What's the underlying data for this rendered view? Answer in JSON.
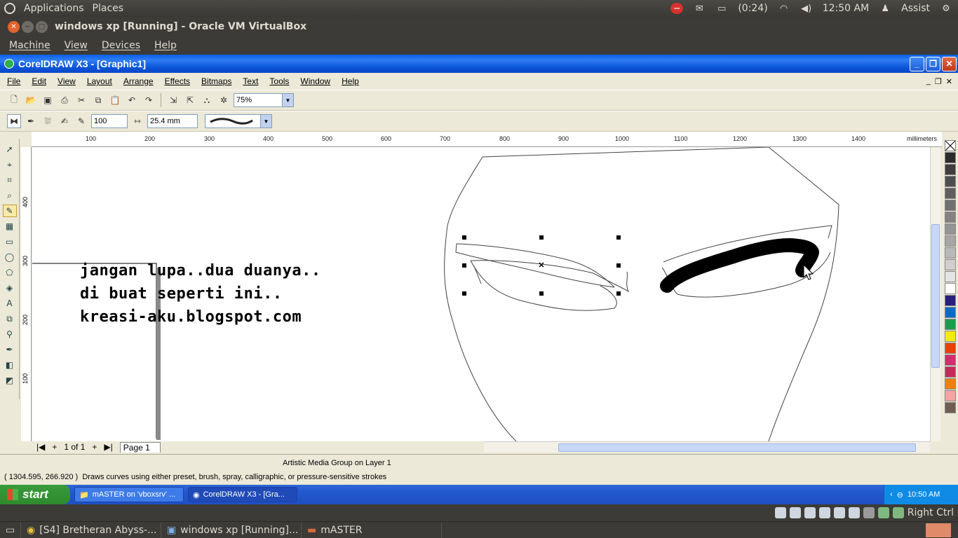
{
  "top_panel": {
    "applications": "Applications",
    "places": "Places",
    "battery": "(0:24)",
    "time": "12:50 AM",
    "user": "Assist"
  },
  "vbox": {
    "title": "windows xp [Running] - Oracle VM VirtualBox",
    "menu": [
      "Machine",
      "View",
      "Devices",
      "Help"
    ],
    "host_key": "Right Ctrl"
  },
  "coreldraw": {
    "title": "CorelDRAW X3 - [Graphic1]",
    "menu": [
      "File",
      "Edit",
      "View",
      "Layout",
      "Arrange",
      "Effects",
      "Bitmaps",
      "Text",
      "Tools",
      "Window",
      "Help"
    ],
    "zoom": "75%",
    "smoothing": "100",
    "width": "25.4 mm",
    "ruler_unit": "millimeters",
    "ruler_h": [
      "100",
      "200",
      "300",
      "400",
      "500",
      "600",
      "700",
      "800",
      "900",
      "1000",
      "1100",
      "1200",
      "1300",
      "1400"
    ],
    "ruler_v": [
      "400",
      "300",
      "200",
      "100"
    ],
    "canvas_text": [
      "jangan lupa..dua duanya..",
      "di buat seperti ini..",
      "kreasi-aku.blogspot.com"
    ],
    "page_count": "1 of 1",
    "page_tab": "Page 1",
    "status_object": "Artistic Media Group on Layer 1",
    "status_coords": "( 1304.595, 266.920 )",
    "status_hint": "Draws curves using either preset, brush, spray, calligraphic, or pressure-sensitive strokes",
    "palette": [
      "#2b2b2b",
      "#3d3d3d",
      "#4e4e4e",
      "#5f5f5f",
      "#707070",
      "#828282",
      "#949494",
      "#a6a6a6",
      "#b9b9b9",
      "#cfcfcf",
      "#e4e4e4",
      "#ffffff",
      "#2a1f7a",
      "#0a6bc4",
      "#1c9c4a",
      "#f4ea11",
      "#e8410c",
      "#d22d6e",
      "#c22c58",
      "#f07f12",
      "#f5a3a3",
      "#6e5e52"
    ]
  },
  "xp_taskbar": {
    "start": "start",
    "buttons": [
      "mASTER on 'vboxsrv' ...",
      "CorelDRAW X3 - [Gra..."
    ],
    "clock": "10:50 AM"
  },
  "bottom_panel": {
    "tasks": [
      "[S4] Bretheran Abyss-...",
      "windows xp [Running]...",
      "mASTER"
    ]
  }
}
